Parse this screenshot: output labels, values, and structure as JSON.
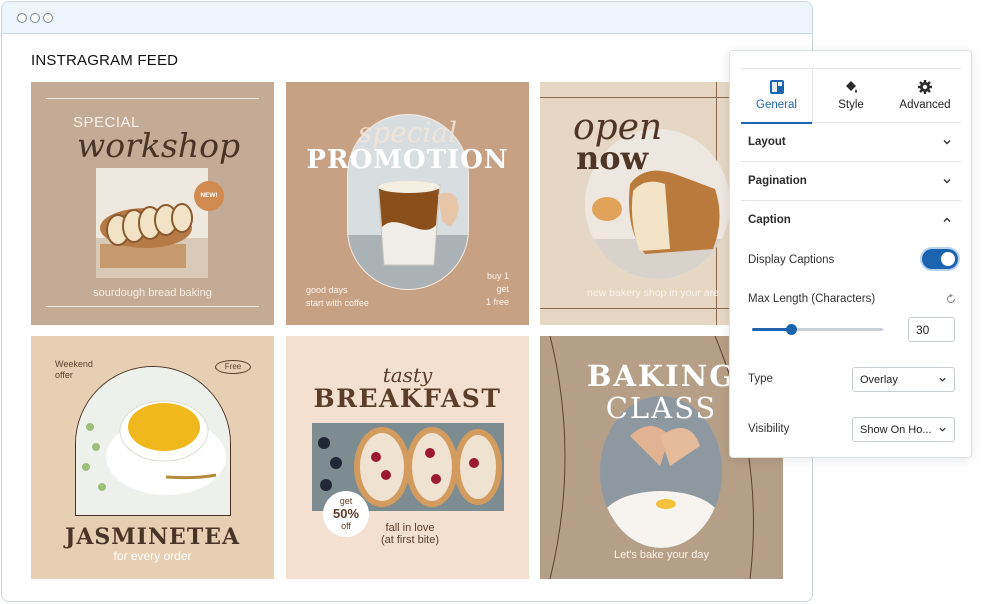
{
  "window": {
    "title": "INSTRAGRAM FEED"
  },
  "feed": {
    "tiles": [
      {
        "id": "workshop",
        "line1": "SPECIAL",
        "line2": "workshop",
        "badge": "NEW!",
        "caption": "sourdough bread baking"
      },
      {
        "id": "promotion",
        "line1": "special",
        "line2": "PROMOTION",
        "left_text": [
          "good days",
          "start with coffee"
        ],
        "right_text": [
          "buy 1",
          "get",
          "1 free"
        ]
      },
      {
        "id": "opennow",
        "line1": "open",
        "line2": "now",
        "caption": "new bakery shop in your are"
      },
      {
        "id": "jasmine",
        "corner_text": [
          "Weekend",
          "offer"
        ],
        "badge": "Free",
        "title": "JASMINETEA",
        "subtitle": "for every order"
      },
      {
        "id": "breakfast",
        "line1": "tasty",
        "line2": "BREAKFAST",
        "badge": [
          "get",
          "50%",
          "off"
        ],
        "caption": [
          "fall in love",
          "(at first bite)"
        ]
      },
      {
        "id": "baking",
        "line1": "BAKING",
        "line2": "CLASS",
        "caption": "Let's bake your day"
      }
    ]
  },
  "panel": {
    "tabs": [
      {
        "label": "General",
        "icon": "layout-icon",
        "active": true
      },
      {
        "label": "Style",
        "icon": "paint-bucket-icon",
        "active": false
      },
      {
        "label": "Advanced",
        "icon": "gear-icon",
        "active": false
      }
    ],
    "sections": [
      {
        "label": "Layout",
        "expanded": false
      },
      {
        "label": "Pagination",
        "expanded": false
      },
      {
        "label": "Caption",
        "expanded": true
      }
    ],
    "caption": {
      "display_captions_label": "Display Captions",
      "display_captions_on": true,
      "max_length_label": "Max Length (Characters)",
      "max_length_value": "30",
      "max_length_slider_fraction": 0.3,
      "type_label": "Type",
      "type_value": "Overlay",
      "visibility_label": "Visibility",
      "visibility_value": "Show On Ho..."
    }
  },
  "colors": {
    "accent": "#1d64b0"
  }
}
